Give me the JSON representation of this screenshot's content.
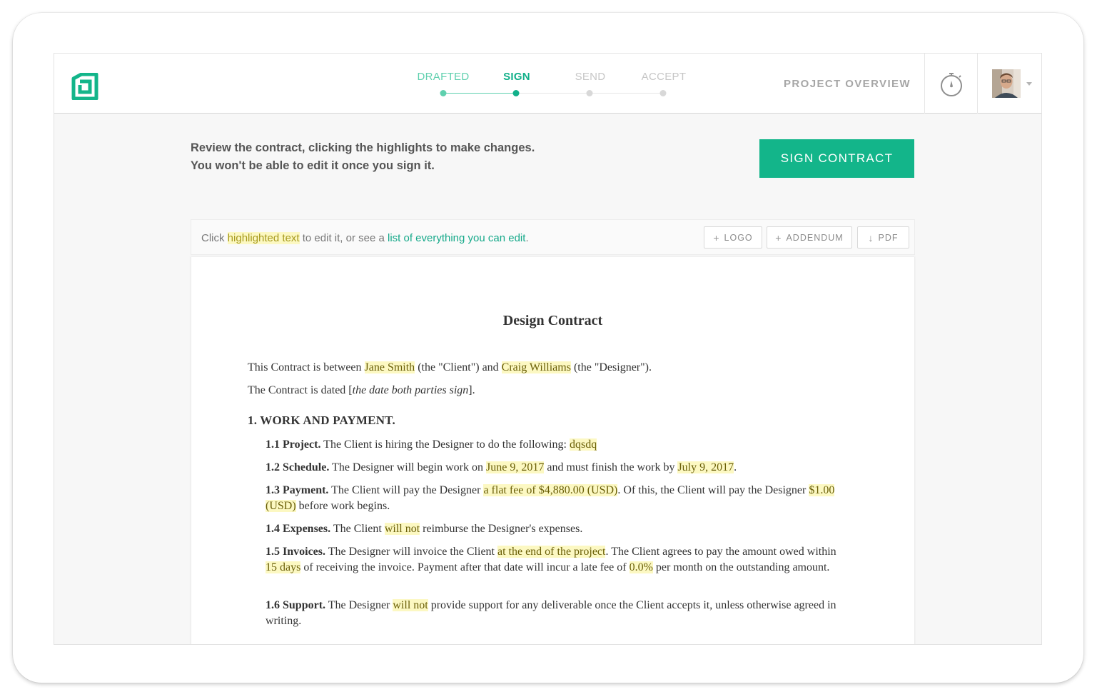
{
  "header": {
    "logo_icon": "bonsai-logo-icon",
    "steps": [
      {
        "label": "DRAFTED",
        "state": "done"
      },
      {
        "label": "SIGN",
        "state": "current"
      },
      {
        "label": "SEND",
        "state": "upcoming"
      },
      {
        "label": "ACCEPT",
        "state": "upcoming"
      }
    ],
    "project_overview": "PROJECT OVERVIEW",
    "timer_icon": "stopwatch-icon",
    "avatar_icon": "user-avatar",
    "menu_icon": "caret-down-icon"
  },
  "instructions": {
    "line1": "Review the contract, clicking the highlights to make changes.",
    "line2": "You won't be able to edit it once you sign it."
  },
  "sign_button": "SIGN CONTRACT",
  "toolbar": {
    "text_before": "Click ",
    "highlight_text": "highlighted text",
    "text_middle": " to edit it, or see a ",
    "list_link": "list of everything you can edit",
    "text_after": ".",
    "logo_btn": "LOGO",
    "addendum_btn": "ADDENDUM",
    "pdf_btn": "PDF"
  },
  "contract": {
    "title": "Design Contract",
    "intro": {
      "p1_a": "This Contract is between ",
      "client": "Jane Smith",
      "p1_b": " (the \"Client\") and ",
      "designer": "Craig Williams",
      "p1_c": " (the \"Designer\").",
      "p2_a": "The Contract is dated [",
      "p2_date": "the date both parties sign",
      "p2_b": "]."
    },
    "section1": "1. WORK AND PAYMENT.",
    "clauses": {
      "c11_head": "1.1 Project.",
      "c11_text": " The Client is hiring the Designer to do the following: ",
      "c11_hl": "dqsdq",
      "c12_head": "1.2 Schedule.",
      "c12_a": " The Designer will begin work on ",
      "c12_start": "June 9, 2017",
      "c12_b": " and must finish the work by ",
      "c12_end": "July 9, 2017",
      "c12_c": ".",
      "c13_head": "1.3 Payment.",
      "c13_a": " The Client will pay the Designer ",
      "c13_fee": "a flat fee of $4,880.00 (USD)",
      "c13_b": ". Of this, the Client will pay the Designer ",
      "c13_deposit": "$1.00 (USD)",
      "c13_c": " before work begins.",
      "c14_head": "1.4 Expenses.",
      "c14_a": " The Client ",
      "c14_hl": "will not",
      "c14_b": " reimburse the Designer's expenses.",
      "c15_head": "1.5 Invoices.",
      "c15_a": " The Designer will invoice the Client ",
      "c15_when": "at the end of the project",
      "c15_b": ". The Client agrees to pay the amount owed within ",
      "c15_days": "15 days",
      "c15_c": " of receiving the invoice. Payment after that date will incur a late fee of ",
      "c15_fee": "0.0%",
      "c15_d": " per month on the outstanding amount.",
      "c16_head": "1.6 Support.",
      "c16_a": " The Designer ",
      "c16_hl": "will not",
      "c16_b": " provide support for any deliverable once the Client accepts it, unless otherwise agreed in writing."
    }
  },
  "colors": {
    "accent": "#13b58a",
    "step_done": "#5fd0ae",
    "highlight_bg": "#fcf8c2"
  }
}
